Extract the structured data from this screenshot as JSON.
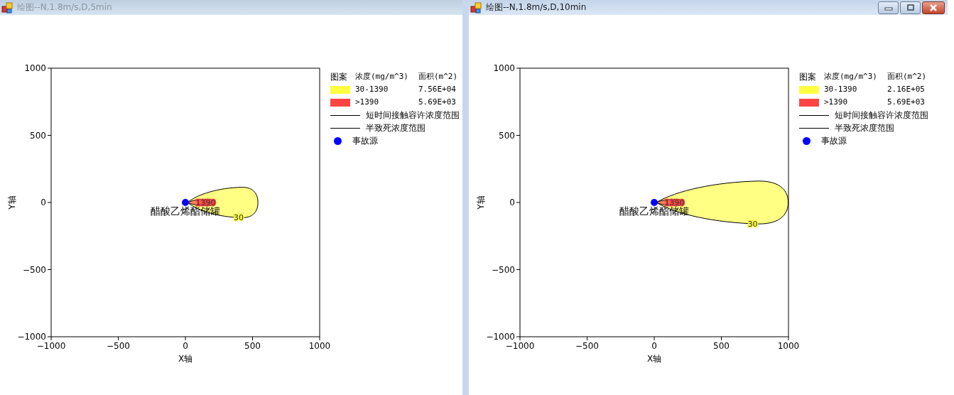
{
  "windows": [
    {
      "title": "绘图--N,1.8m/s,D,5min",
      "active": false,
      "legend": {
        "header": [
          "图案",
          "浓度(mg/m^3)",
          "面积(m^2)"
        ],
        "items": [
          {
            "kind": "fill",
            "color": "#ffff40",
            "range": "30-1390",
            "area": "7.56E+04"
          },
          {
            "kind": "fill",
            "color": "#ff4444",
            "range": ">1390",
            "area": "5.69E+03"
          },
          {
            "kind": "line",
            "label": "短时间接触容许浓度范围"
          },
          {
            "kind": "line",
            "label": "半致死浓度范围"
          },
          {
            "kind": "dot",
            "color": "#0000ff",
            "label": "事故源"
          }
        ]
      },
      "chart_data": {
        "type": "scatter",
        "xlabel": "X轴",
        "ylabel": "Y轴",
        "xlim": [
          -1000,
          1000
        ],
        "ylim": [
          -1000,
          1000
        ],
        "xticks": [
          -1000,
          -500,
          0,
          500,
          1000
        ],
        "yticks": [
          -1000,
          -500,
          0,
          500,
          1000
        ],
        "x": [
          0
        ],
        "series": [
          {
            "color": "#0000ff",
            "values": [
              0
            ]
          }
        ],
        "annotations": [
          "30",
          "1390",
          "醋酸乙烯酯储罐"
        ]
      }
    },
    {
      "title": "绘图--N,1.8m/s,D,10min",
      "active": true,
      "buttons": [
        {
          "kind": "minimize"
        },
        {
          "kind": "maximize"
        },
        {
          "kind": "close"
        }
      ],
      "legend": {
        "header": [
          "图案",
          "浓度(mg/m^3)",
          "面积(m^2)"
        ],
        "items": [
          {
            "kind": "fill",
            "color": "#ffff40",
            "range": "30-1390",
            "area": "2.16E+05"
          },
          {
            "kind": "fill",
            "color": "#ff4444",
            "range": ">1390",
            "area": "5.69E+03"
          },
          {
            "kind": "line",
            "label": "短时间接触容许浓度范围"
          },
          {
            "kind": "line",
            "label": "半致死浓度范围"
          },
          {
            "kind": "dot",
            "color": "#0000ff",
            "label": "事故源"
          }
        ]
      },
      "chart_data": {
        "type": "scatter",
        "xlabel": "X轴",
        "ylabel": "Y轴",
        "xlim": [
          -1000,
          1000
        ],
        "ylim": [
          -1000,
          1000
        ],
        "xticks": [
          -1000,
          -500,
          0,
          500,
          1000
        ],
        "yticks": [
          -1000,
          -500,
          0,
          500,
          1000
        ],
        "x": [
          0
        ],
        "series": [
          {
            "color": "#0000ff",
            "values": [
              0
            ]
          }
        ],
        "annotations": [
          "30",
          "1390",
          "醋酸乙烯酯储罐"
        ]
      }
    }
  ]
}
